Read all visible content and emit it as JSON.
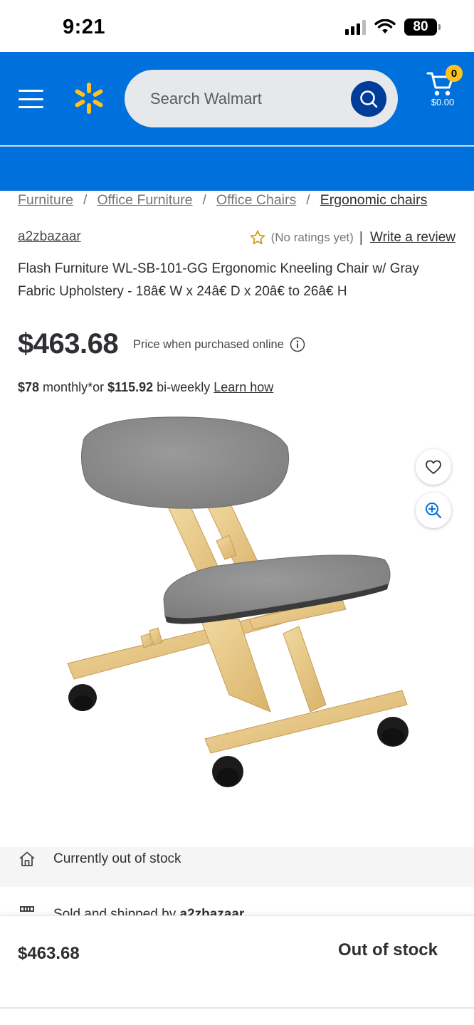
{
  "status_bar": {
    "time": "9:21",
    "battery": "80"
  },
  "header": {
    "search_placeholder": "Search Walmart",
    "cart_count": "0",
    "cart_amount": "$0.00",
    "brand_color": "#0071dc",
    "spark_color": "#ffc220"
  },
  "breadcrumb": {
    "items": [
      "Furniture",
      "Office Furniture",
      "Office Chairs",
      "Ergonomic chairs"
    ],
    "separator": "/"
  },
  "product": {
    "seller": "a2zbazaar",
    "ratings_text": "(No ratings yet)",
    "review_link": "Write a review",
    "title": "Flash Furniture WL-SB-101-GG Ergonomic Kneeling Chair w/ Gray Fabric Upholstery - 18â€ W x 24â€ D x 20â€ to 26â€ H",
    "price": "$463.68",
    "price_note": "Price when purchased online",
    "financing": {
      "monthly_amount": "$78",
      "monthly_label": " monthly*or ",
      "biweekly_amount": "$115.92",
      "biweekly_label": " bi-weekly ",
      "learn_link": "Learn how"
    }
  },
  "availability": {
    "stock_text": "Currently out of stock",
    "sold_by_prefix": "Sold and shipped by ",
    "sold_by_name": "a2zbazaar"
  },
  "bottom_bar": {
    "price": "$463.68",
    "status": "Out of stock"
  },
  "icons": {
    "menu": "menu-icon",
    "spark": "spark-icon",
    "search": "search-icon",
    "cart": "cart-icon",
    "star": "star-icon",
    "info": "info-icon",
    "favorite": "heart-icon",
    "zoom": "zoom-in-icon",
    "home": "home-icon",
    "store": "store-icon"
  }
}
